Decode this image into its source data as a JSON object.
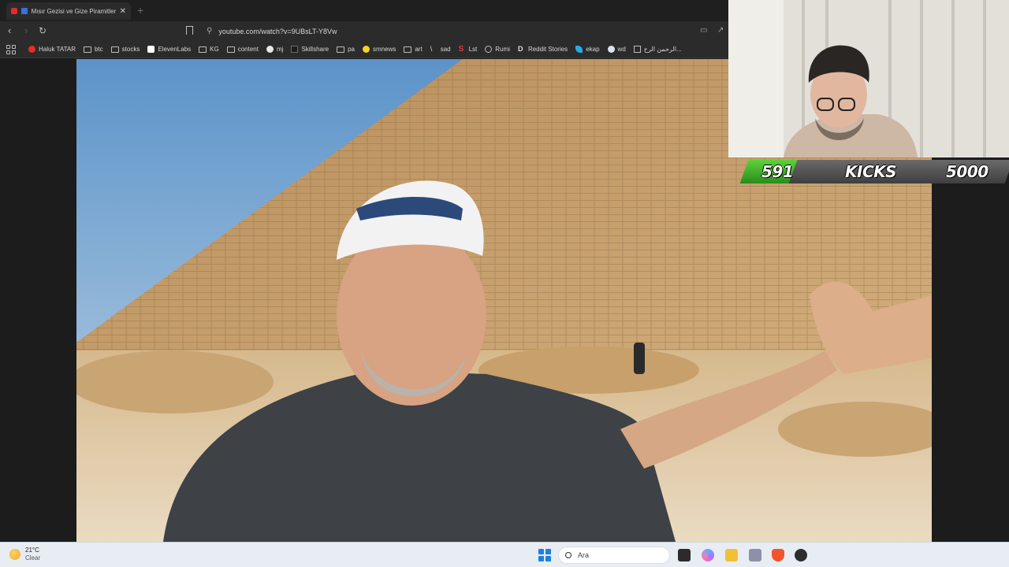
{
  "browser": {
    "tab_title": "Mısır Gezisi ve Gize Piramitleri",
    "url": "youtube.com/watch?v=9UBsLT-Y8Vw",
    "bookmarks": [
      {
        "label": "Haluk TATAR",
        "icon": "youtube-icon"
      },
      {
        "label": "btc",
        "icon": "folder-icon"
      },
      {
        "label": "stocks",
        "icon": "folder-icon"
      },
      {
        "label": "ElevenLabs",
        "icon": "elevenlabs-icon"
      },
      {
        "label": "KG",
        "icon": "folder-icon"
      },
      {
        "label": "content",
        "icon": "folder-icon"
      },
      {
        "label": "mj",
        "icon": "github-icon"
      },
      {
        "label": "Skillshare",
        "icon": "skillshare-icon"
      },
      {
        "label": "pa",
        "icon": "folder-icon"
      },
      {
        "label": "smnews",
        "icon": "emoji-icon"
      },
      {
        "label": "art",
        "icon": "folder-icon"
      },
      {
        "label": "sad",
        "icon": "feather-icon"
      },
      {
        "label": "Lst",
        "icon": "s-icon"
      },
      {
        "label": "Rumi",
        "icon": "globe-icon"
      },
      {
        "label": "Reddit Stories",
        "icon": "d-icon"
      },
      {
        "label": "ekap",
        "icon": "bird-icon"
      },
      {
        "label": "wd",
        "icon": "circle-icon"
      },
      {
        "label": "الرحمن الرح...",
        "icon": "book-icon"
      }
    ]
  },
  "counter": {
    "current": "591",
    "label": "KICKS",
    "goal": "5000"
  },
  "taskbar": {
    "temperature": "21°C",
    "condition": "Clear",
    "search_placeholder": "Ara"
  },
  "colors": {
    "counter_green": "#3fae2a",
    "chrome_dark": "#2b2b2b",
    "taskbar_bg": "#e7edf3"
  }
}
